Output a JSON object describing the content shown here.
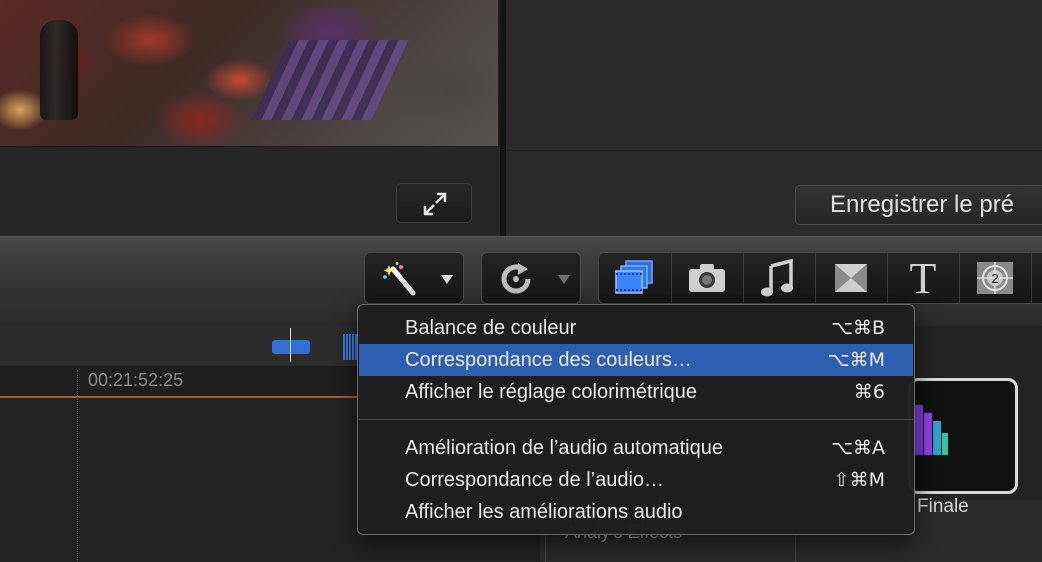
{
  "viewer": {
    "save_preset_label": "Enregistrer le pré"
  },
  "timeline": {
    "timecode": "00:21:52:25"
  },
  "inspector": {
    "partial_text": "Analy's Effects"
  },
  "media_tile": {
    "label": "Finale"
  },
  "toolbar": {
    "enhance_icon": "magic-wand-icon",
    "retime_icon": "retime-icon",
    "browser_icons": [
      "clip-browser-icon",
      "camera-icon",
      "music-icon",
      "transitions-icon",
      "titles-icon",
      "generators-icon"
    ]
  },
  "enhance_menu": {
    "groups": [
      [
        {
          "label": "Balance de couleur",
          "shortcut": "⌥⌘B",
          "selected": false
        },
        {
          "label": "Correspondance des couleurs…",
          "shortcut": "⌥⌘M",
          "selected": true
        },
        {
          "label": "Afficher le réglage colorimétrique",
          "shortcut": "⌘6",
          "selected": false
        }
      ],
      [
        {
          "label": "Amélioration de l’audio automatique",
          "shortcut": "⌥⌘A",
          "selected": false
        },
        {
          "label": "Correspondance de l’audio…",
          "shortcut": "⇧⌘M",
          "selected": false
        },
        {
          "label": "Afficher les améliorations audio",
          "shortcut": "",
          "selected": false
        }
      ]
    ]
  },
  "colors": {
    "menu_selection": "#2c5fb0",
    "active_browser_icon": "#3a86ff",
    "timeline_orange": "#b65a1a"
  }
}
